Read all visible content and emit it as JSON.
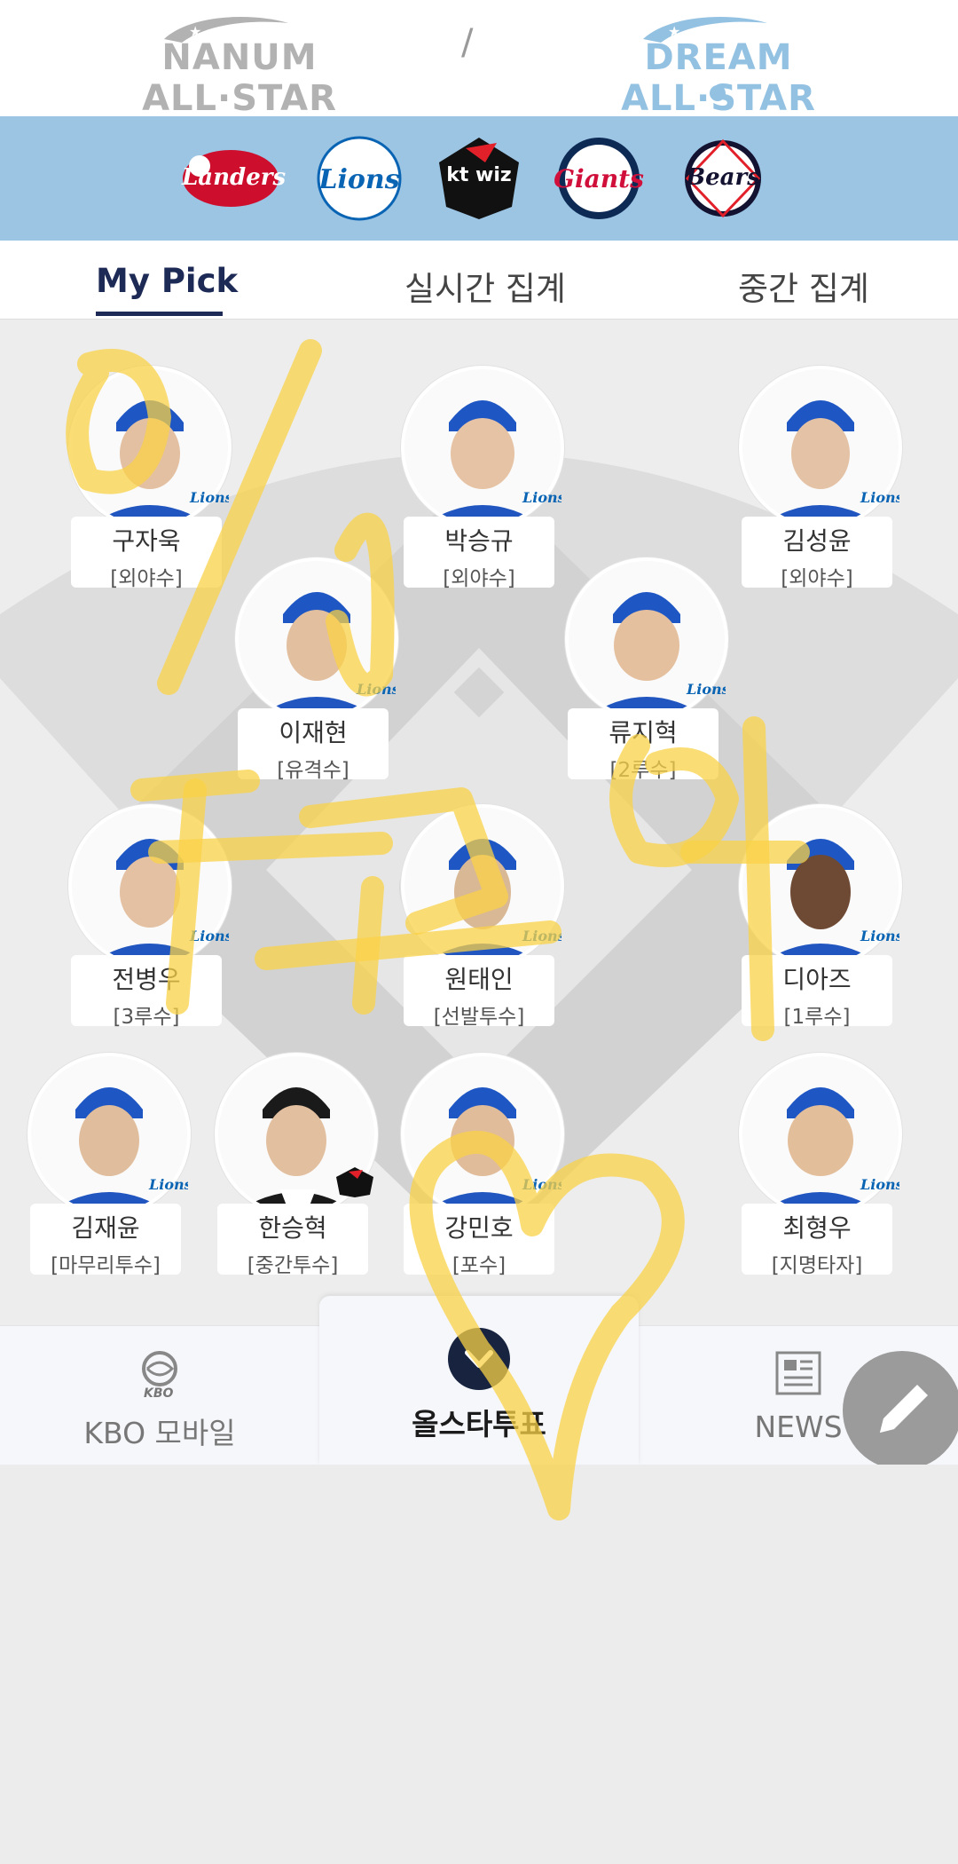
{
  "header": {
    "leagues": [
      {
        "name": "NANUM ALL·STAR",
        "active": false
      },
      {
        "name": "DREAM ALL·STAR",
        "active": true
      }
    ],
    "separator": "/"
  },
  "teams": [
    {
      "name": "SSG Landers",
      "display": "Landers",
      "color": "#ce0e2d"
    },
    {
      "name": "Samsung Lions",
      "display": "Lions",
      "color": "#0a64b4"
    },
    {
      "name": "kt wiz",
      "display": "kt wiz",
      "color": "#111111"
    },
    {
      "name": "Lotte Giants",
      "display": "Giants",
      "color": "#d0103a"
    },
    {
      "name": "Doosan Bears",
      "display": "Bears",
      "color": "#131230"
    }
  ],
  "tabs": [
    {
      "label": "My Pick",
      "active": true
    },
    {
      "label": "실시간 집계",
      "active": false
    },
    {
      "label": "중간 집계",
      "active": false
    }
  ],
  "players": [
    {
      "name": "구자욱",
      "position": "[외야수]",
      "team": "Lions"
    },
    {
      "name": "박승규",
      "position": "[외야수]",
      "team": "Lions"
    },
    {
      "name": "김성윤",
      "position": "[외야수]",
      "team": "Lions"
    },
    {
      "name": "이재현",
      "position": "[유격수]",
      "team": "Lions"
    },
    {
      "name": "류지혁",
      "position": "[2루수]",
      "team": "Lions"
    },
    {
      "name": "전병우",
      "position": "[3루수]",
      "team": "Lions"
    },
    {
      "name": "원태인",
      "position": "[선발투수]",
      "team": "Lions"
    },
    {
      "name": "디아즈",
      "position": "[1루수]",
      "team": "Lions"
    },
    {
      "name": "김재윤",
      "position": "[마무리투수]",
      "team": "Lions"
    },
    {
      "name": "한승혁",
      "position": "[중간투수]",
      "team": "kt wiz"
    },
    {
      "name": "강민호",
      "position": "[포수]",
      "team": "Lions"
    },
    {
      "name": "최형우",
      "position": "[지명타자]",
      "team": "Lions"
    }
  ],
  "bottom_nav": {
    "left": {
      "label": "KBO 모바일",
      "icon": "kbo-logo-icon",
      "icon_text": "KBO"
    },
    "center": {
      "label": "올스타투표",
      "icon": "chevron-down-icon"
    },
    "right": {
      "label": "NEWS",
      "icon": "newspaper-icon"
    },
    "fab_icon": "pencil-icon"
  },
  "colors": {
    "team_strip": "#9cc5e4",
    "active_tab": "#1c2a55",
    "dream_accent": "#93c1e2",
    "nanum_gray": "#b2b2b2",
    "scribble": "#f9d247"
  }
}
